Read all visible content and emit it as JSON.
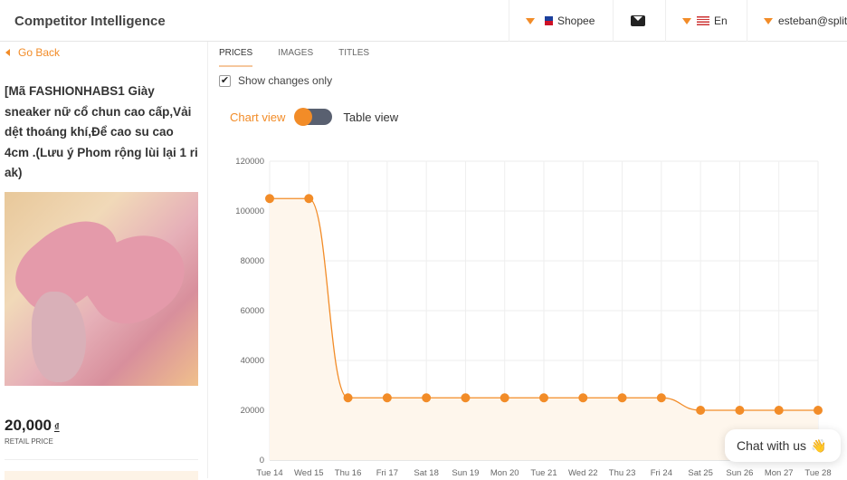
{
  "header": {
    "title": "Competitor Intelligence",
    "marketplace": "Shopee",
    "language": "En",
    "user": "esteban@splitc",
    "mail_icon": "mail-icon"
  },
  "sidebar": {
    "go_back": "Go Back",
    "product_title": "[Mã FASHIONHABS1 Giày sneaker nữ cổ chun cao cấp,Vải dệt thoáng khí,Để cao su cao 4cm .(Lưu ý Phom rộng lùi lại 1 ri ak)",
    "price": "20,000",
    "currency": "₫",
    "price_label": "RETAIL PRICE"
  },
  "tabs": [
    {
      "label": "PRICES",
      "active": true
    },
    {
      "label": "IMAGES"
    },
    {
      "label": "TITLES"
    }
  ],
  "show_changes": {
    "label": "Show changes only",
    "checked": true
  },
  "view_toggle": {
    "chart_label": "Chart view",
    "table_label": "Table view",
    "selected": "chart"
  },
  "colors": {
    "accent": "#f28c28",
    "toggle": "#596070"
  },
  "chat": {
    "label": "Chat with us",
    "icon": "waving-hand-icon"
  },
  "chart_data": {
    "type": "area",
    "categories": [
      "Tue 14",
      "Wed 15",
      "Thu 16",
      "Fri 17",
      "Sat 18",
      "Sun 19",
      "Mon 20",
      "Tue 21",
      "Wed 22",
      "Thu 23",
      "Fri 24",
      "Sat 25",
      "Sun 26",
      "Mon 27",
      "Tue 28"
    ],
    "values": [
      105000,
      105000,
      25000,
      25000,
      25000,
      25000,
      25000,
      25000,
      25000,
      25000,
      25000,
      20000,
      20000,
      20000,
      20000
    ],
    "yticks": [
      0,
      20000,
      40000,
      60000,
      80000,
      100000,
      120000
    ],
    "ylim": [
      0,
      120000
    ],
    "grid": true,
    "color": "#f28c28"
  }
}
